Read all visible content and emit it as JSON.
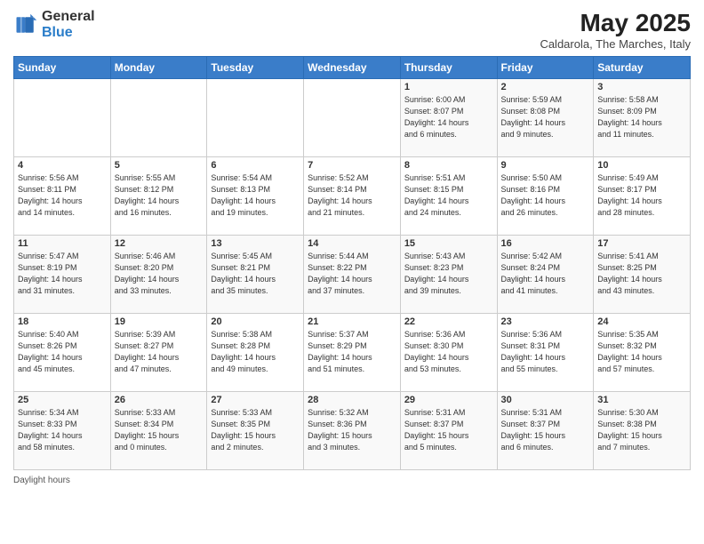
{
  "header": {
    "logo_general": "General",
    "logo_blue": "Blue",
    "month_title": "May 2025",
    "subtitle": "Caldarola, The Marches, Italy"
  },
  "days_of_week": [
    "Sunday",
    "Monday",
    "Tuesday",
    "Wednesday",
    "Thursday",
    "Friday",
    "Saturday"
  ],
  "weeks": [
    [
      {
        "day": "",
        "info": ""
      },
      {
        "day": "",
        "info": ""
      },
      {
        "day": "",
        "info": ""
      },
      {
        "day": "",
        "info": ""
      },
      {
        "day": "1",
        "info": "Sunrise: 6:00 AM\nSunset: 8:07 PM\nDaylight: 14 hours\nand 6 minutes."
      },
      {
        "day": "2",
        "info": "Sunrise: 5:59 AM\nSunset: 8:08 PM\nDaylight: 14 hours\nand 9 minutes."
      },
      {
        "day": "3",
        "info": "Sunrise: 5:58 AM\nSunset: 8:09 PM\nDaylight: 14 hours\nand 11 minutes."
      }
    ],
    [
      {
        "day": "4",
        "info": "Sunrise: 5:56 AM\nSunset: 8:11 PM\nDaylight: 14 hours\nand 14 minutes."
      },
      {
        "day": "5",
        "info": "Sunrise: 5:55 AM\nSunset: 8:12 PM\nDaylight: 14 hours\nand 16 minutes."
      },
      {
        "day": "6",
        "info": "Sunrise: 5:54 AM\nSunset: 8:13 PM\nDaylight: 14 hours\nand 19 minutes."
      },
      {
        "day": "7",
        "info": "Sunrise: 5:52 AM\nSunset: 8:14 PM\nDaylight: 14 hours\nand 21 minutes."
      },
      {
        "day": "8",
        "info": "Sunrise: 5:51 AM\nSunset: 8:15 PM\nDaylight: 14 hours\nand 24 minutes."
      },
      {
        "day": "9",
        "info": "Sunrise: 5:50 AM\nSunset: 8:16 PM\nDaylight: 14 hours\nand 26 minutes."
      },
      {
        "day": "10",
        "info": "Sunrise: 5:49 AM\nSunset: 8:17 PM\nDaylight: 14 hours\nand 28 minutes."
      }
    ],
    [
      {
        "day": "11",
        "info": "Sunrise: 5:47 AM\nSunset: 8:19 PM\nDaylight: 14 hours\nand 31 minutes."
      },
      {
        "day": "12",
        "info": "Sunrise: 5:46 AM\nSunset: 8:20 PM\nDaylight: 14 hours\nand 33 minutes."
      },
      {
        "day": "13",
        "info": "Sunrise: 5:45 AM\nSunset: 8:21 PM\nDaylight: 14 hours\nand 35 minutes."
      },
      {
        "day": "14",
        "info": "Sunrise: 5:44 AM\nSunset: 8:22 PM\nDaylight: 14 hours\nand 37 minutes."
      },
      {
        "day": "15",
        "info": "Sunrise: 5:43 AM\nSunset: 8:23 PM\nDaylight: 14 hours\nand 39 minutes."
      },
      {
        "day": "16",
        "info": "Sunrise: 5:42 AM\nSunset: 8:24 PM\nDaylight: 14 hours\nand 41 minutes."
      },
      {
        "day": "17",
        "info": "Sunrise: 5:41 AM\nSunset: 8:25 PM\nDaylight: 14 hours\nand 43 minutes."
      }
    ],
    [
      {
        "day": "18",
        "info": "Sunrise: 5:40 AM\nSunset: 8:26 PM\nDaylight: 14 hours\nand 45 minutes."
      },
      {
        "day": "19",
        "info": "Sunrise: 5:39 AM\nSunset: 8:27 PM\nDaylight: 14 hours\nand 47 minutes."
      },
      {
        "day": "20",
        "info": "Sunrise: 5:38 AM\nSunset: 8:28 PM\nDaylight: 14 hours\nand 49 minutes."
      },
      {
        "day": "21",
        "info": "Sunrise: 5:37 AM\nSunset: 8:29 PM\nDaylight: 14 hours\nand 51 minutes."
      },
      {
        "day": "22",
        "info": "Sunrise: 5:36 AM\nSunset: 8:30 PM\nDaylight: 14 hours\nand 53 minutes."
      },
      {
        "day": "23",
        "info": "Sunrise: 5:36 AM\nSunset: 8:31 PM\nDaylight: 14 hours\nand 55 minutes."
      },
      {
        "day": "24",
        "info": "Sunrise: 5:35 AM\nSunset: 8:32 PM\nDaylight: 14 hours\nand 57 minutes."
      }
    ],
    [
      {
        "day": "25",
        "info": "Sunrise: 5:34 AM\nSunset: 8:33 PM\nDaylight: 14 hours\nand 58 minutes."
      },
      {
        "day": "26",
        "info": "Sunrise: 5:33 AM\nSunset: 8:34 PM\nDaylight: 15 hours\nand 0 minutes."
      },
      {
        "day": "27",
        "info": "Sunrise: 5:33 AM\nSunset: 8:35 PM\nDaylight: 15 hours\nand 2 minutes."
      },
      {
        "day": "28",
        "info": "Sunrise: 5:32 AM\nSunset: 8:36 PM\nDaylight: 15 hours\nand 3 minutes."
      },
      {
        "day": "29",
        "info": "Sunrise: 5:31 AM\nSunset: 8:37 PM\nDaylight: 15 hours\nand 5 minutes."
      },
      {
        "day": "30",
        "info": "Sunrise: 5:31 AM\nSunset: 8:37 PM\nDaylight: 15 hours\nand 6 minutes."
      },
      {
        "day": "31",
        "info": "Sunrise: 5:30 AM\nSunset: 8:38 PM\nDaylight: 15 hours\nand 7 minutes."
      }
    ]
  ],
  "footer": {
    "text": "Daylight hours"
  }
}
